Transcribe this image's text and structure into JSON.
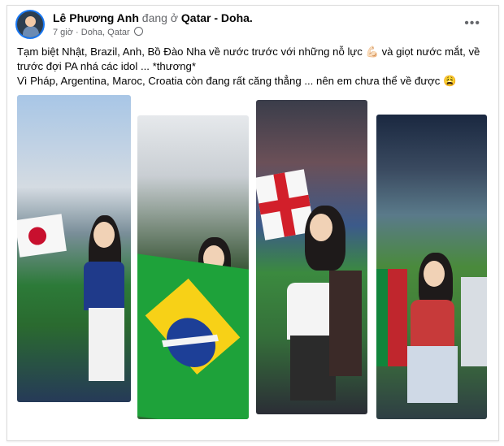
{
  "post": {
    "author": "Lê Phương Anh",
    "action": "đang ở",
    "place": "Qatar - Doha.",
    "time": "7 giờ",
    "location": "Doha, Qatar",
    "more_label": "•••",
    "text_line1": "Tạm biệt Nhật, Brazil, Anh, Bồ Đào Nha về nước trước với những nỗ lực 💪🏻 và giọt nước mắt, về",
    "text_line2": "trước đợi PA nhá các idol ...  *thương*",
    "text_line3": "Vì Pháp, Argentina, Maroc, Croatia còn đang rất căng thẳng ... nên em chưa thể về được 😩"
  },
  "photos": [
    {
      "flag": "Japan"
    },
    {
      "flag": "Brazil",
      "banner_text": "ORDEM E PROGRESSO"
    },
    {
      "flag": "England"
    },
    {
      "flag": "Portugal"
    }
  ],
  "colors": {
    "link": "#1877f2",
    "secondary": "#65676b"
  }
}
